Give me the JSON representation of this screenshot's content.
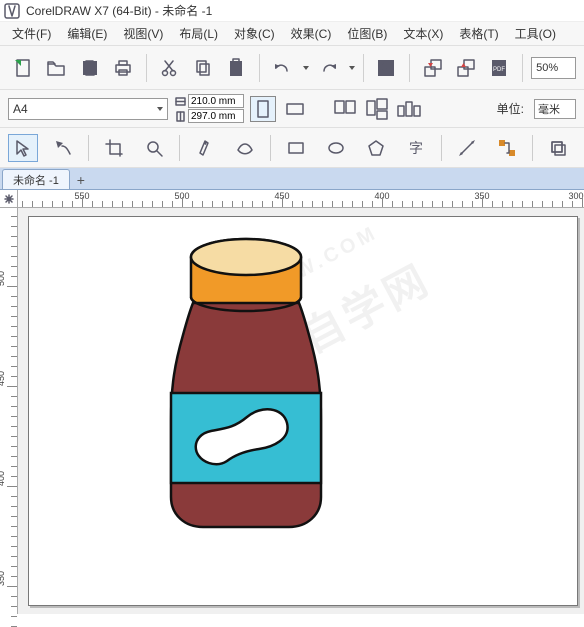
{
  "app": {
    "name": "CorelDRAW X7 (64-Bit)",
    "doc": "未命名 -1"
  },
  "menu": {
    "file": "文件(F)",
    "edit": "编辑(E)",
    "view": "视图(V)",
    "layout": "布局(L)",
    "object": "对象(C)",
    "effect": "效果(C)",
    "bitmap": "位图(B)",
    "text": "文本(X)",
    "table": "表格(T)",
    "tools": "工具(O)"
  },
  "toolbar": {
    "zoom": "50%"
  },
  "prop": {
    "page_size": "A4",
    "width": "210.0 mm",
    "height": "297.0 mm",
    "units_label": "单位:",
    "units_value": "毫米"
  },
  "tabs": {
    "doc": "未命名 -1"
  },
  "ruler_h": [
    "550",
    "500",
    "450",
    "400",
    "350",
    "300"
  ],
  "ruler_v": [
    "500",
    "450",
    "400",
    "350"
  ],
  "watermark": {
    "cn": "软件自学网",
    "en": "RJZXW.COM"
  },
  "colors": {
    "cap": "#F19A28",
    "lid": "#F6DCA4",
    "body": "#8A3A3A",
    "label": "#36BED3",
    "outline": "#111",
    "page_shadow": "#bbb"
  }
}
